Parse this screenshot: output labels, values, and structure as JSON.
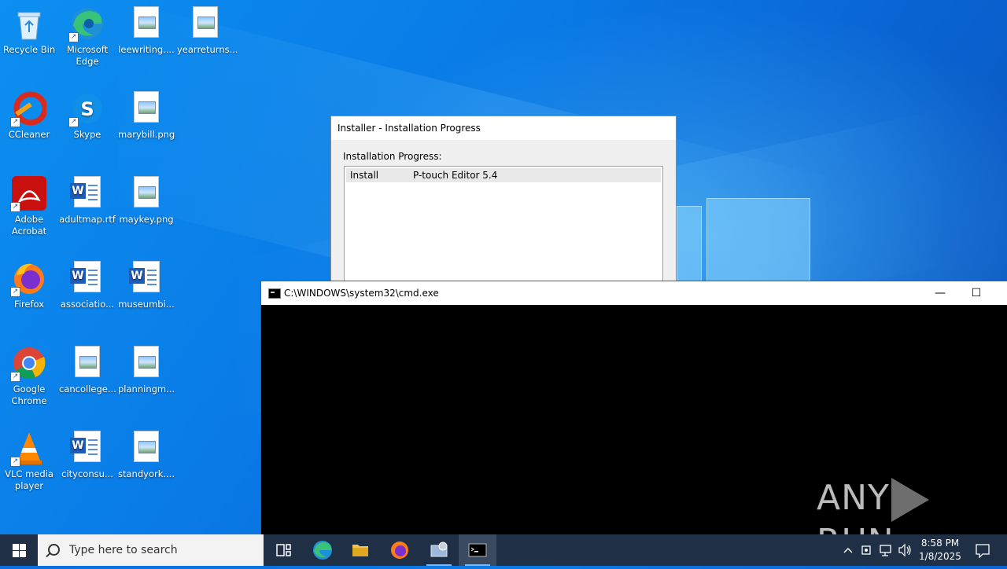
{
  "desktop_icons": [
    {
      "label": "Recycle Bin"
    },
    {
      "label": "Microsoft Edge"
    },
    {
      "label": "leewriting...."
    },
    {
      "label": "yearreturns..."
    },
    {
      "label": "CCleaner"
    },
    {
      "label": "Skype"
    },
    {
      "label": "marybill.png"
    },
    {
      "label": "Adobe Acrobat"
    },
    {
      "label": "adultmap.rtf"
    },
    {
      "label": "maykey.png"
    },
    {
      "label": "Firefox"
    },
    {
      "label": "associatio..."
    },
    {
      "label": "museumbi..."
    },
    {
      "label": "Google Chrome"
    },
    {
      "label": "cancollege..."
    },
    {
      "label": "planningm..."
    },
    {
      "label": "VLC media player"
    },
    {
      "label": "cityconsu..."
    },
    {
      "label": "standyork...."
    }
  ],
  "installer": {
    "title": "Installer - Installation Progress",
    "section_label": "Installation Progress:",
    "rows": [
      {
        "action": "Install",
        "item": "P-touch Editor 5.4"
      }
    ]
  },
  "cmd": {
    "title": "C:\\WINDOWS\\system32\\cmd.exe",
    "minimize": "—",
    "maximize": "☐"
  },
  "watermark": {
    "left": "ANY",
    "right": "RUN"
  },
  "taskbar": {
    "search_placeholder": "Type here to search",
    "time": "8:58 PM",
    "date": "1/8/2025"
  }
}
